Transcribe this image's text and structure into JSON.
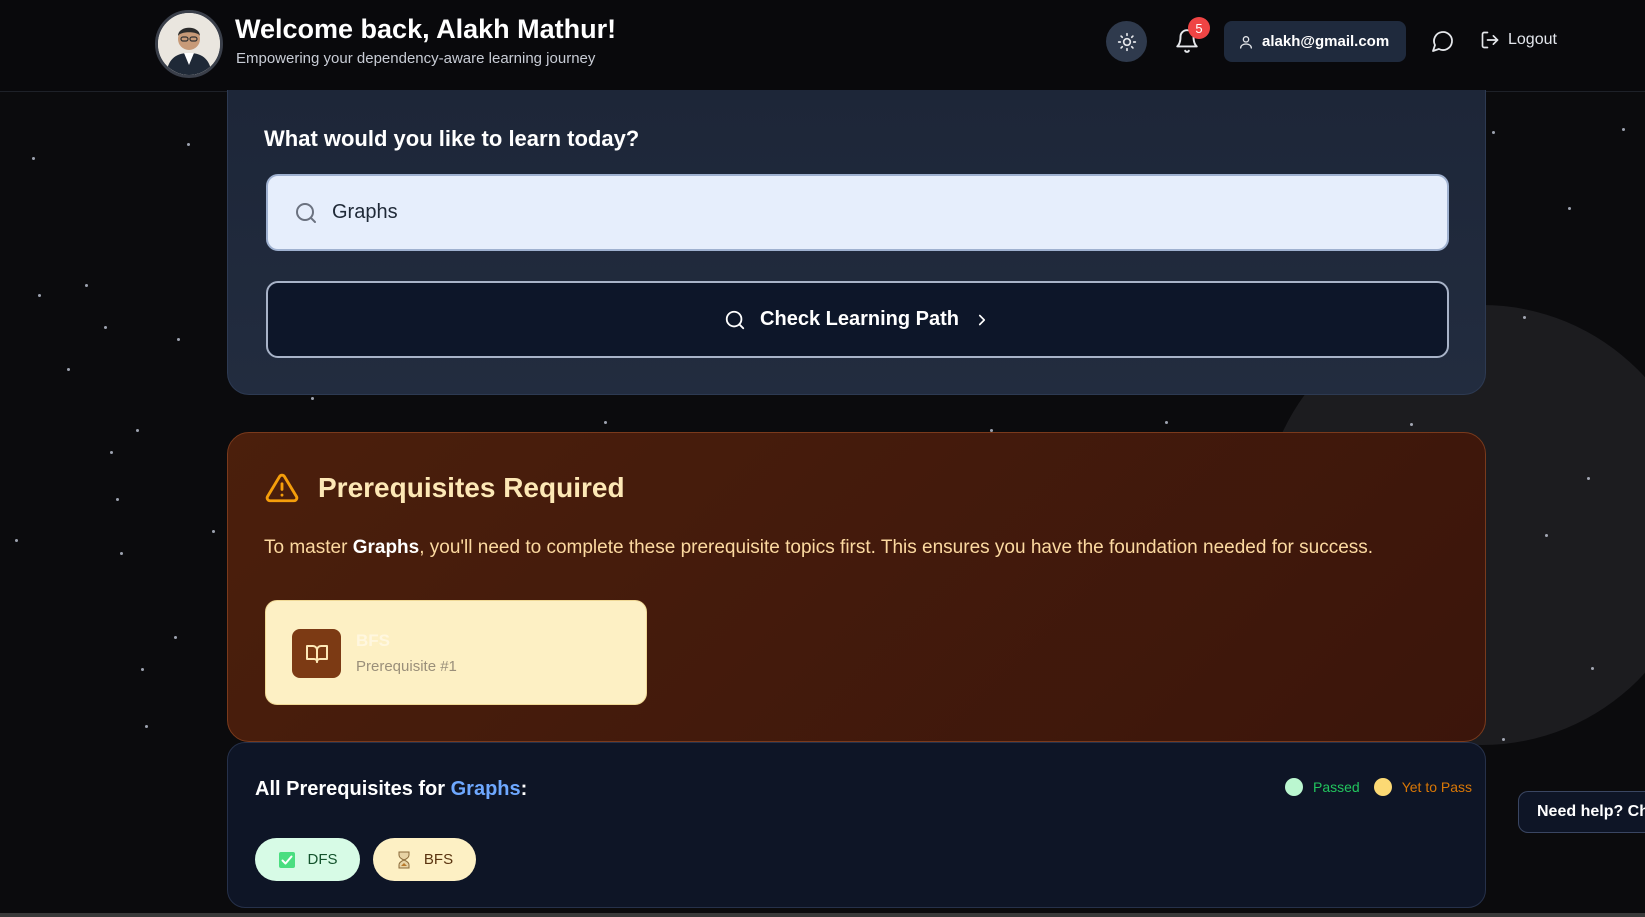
{
  "header": {
    "welcome": "Welcome back, Alakh Mathur!",
    "tagline": "Empowering your dependency-aware learning journey",
    "notification_count": "5",
    "email": "alakh@gmail.com",
    "logout_label": "Logout"
  },
  "search": {
    "heading": "What would you like to learn today?",
    "value": "Graphs",
    "button_label": "Check Learning Path"
  },
  "prereq": {
    "title": "Prerequisites Required",
    "text_before": "To master ",
    "topic": "Graphs",
    "text_after": ", you'll need to complete these prerequisite topics first. This ensures you have the foundation needed for success.",
    "card": {
      "name": "BFS",
      "subtitle": "Prerequisite #1"
    }
  },
  "all_prereqs": {
    "title_prefix": "All Prerequisites for ",
    "topic": "Graphs",
    "title_suffix": ":",
    "legend": {
      "passed": "Passed",
      "yet": "Yet to Pass"
    },
    "chips": [
      {
        "label": "DFS",
        "status": "passed"
      },
      {
        "label": "BFS",
        "status": "yet"
      }
    ]
  },
  "help": {
    "label": "Need help? Chat"
  },
  "colors": {
    "accent_blue": "#6ea8ff",
    "passed": "#bbf7d0",
    "yet": "#fcd974",
    "badge": "#ef4444"
  }
}
